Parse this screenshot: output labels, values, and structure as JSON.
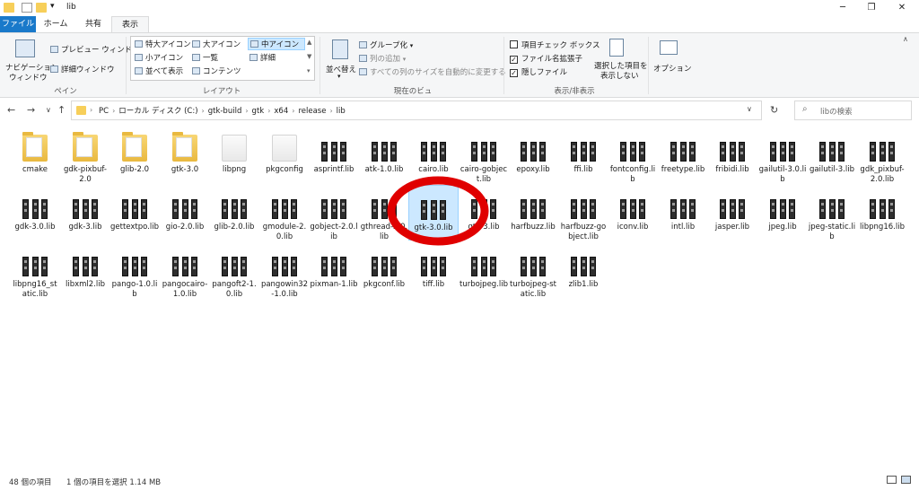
{
  "window": {
    "title": "lib",
    "controls": {
      "minimize": "─",
      "maximize": "❐",
      "close": "✕"
    }
  },
  "tabs": {
    "file": "ファイル",
    "home": "ホーム",
    "share": "共有",
    "view": "表示"
  },
  "ribbon": {
    "pane": {
      "nav_pane_1": "ナビゲーション",
      "nav_pane_2": "ウィンドウ",
      "preview": "プレビュー ウィンドウ",
      "details": "詳細ウィンドウ",
      "group": "ペイン"
    },
    "layout": {
      "extra_large": "特大アイコン",
      "large": "大アイコン",
      "medium": "中アイコン",
      "small": "小アイコン",
      "list": "一覧",
      "details": "詳細",
      "tiles": "並べて表示",
      "content": "コンテンツ",
      "group": "レイアウト"
    },
    "current_view": {
      "sort": "並べ替え",
      "group_by": "グループ化",
      "add_column": "列の追加",
      "fit_columns": "すべての列のサイズを自動的に変更する",
      "group": "現在のビュー"
    },
    "show_hide": {
      "item_checkboxes": "項目チェック ボックス",
      "extensions": "ファイル名拡張子",
      "hidden": "隠しファイル",
      "hide_selected_1": "選択した項目を",
      "hide_selected_2": "表示しない",
      "group": "表示/非表示"
    },
    "options": "オプション"
  },
  "address": {
    "crumbs": [
      "PC",
      "ローカル ディスク (C:)",
      "gtk-build",
      "gtk",
      "x64",
      "release",
      "lib"
    ],
    "search_placeholder": "libの検索"
  },
  "items": [
    {
      "name": "cmake",
      "type": "folder"
    },
    {
      "name": "gdk-pixbuf-2.0",
      "type": "folder"
    },
    {
      "name": "glib-2.0",
      "type": "folder"
    },
    {
      "name": "gtk-3.0",
      "type": "folder"
    },
    {
      "name": "libpng",
      "type": "folder-empty"
    },
    {
      "name": "pkgconfig",
      "type": "folder-empty"
    },
    {
      "name": "asprintf.lib",
      "type": "lib"
    },
    {
      "name": "atk-1.0.lib",
      "type": "lib"
    },
    {
      "name": "cairo.lib",
      "type": "lib"
    },
    {
      "name": "cairo-gobject.lib",
      "type": "lib"
    },
    {
      "name": "epoxy.lib",
      "type": "lib"
    },
    {
      "name": "ffi.lib",
      "type": "lib"
    },
    {
      "name": "fontconfig.lib",
      "type": "lib"
    },
    {
      "name": "freetype.lib",
      "type": "lib"
    },
    {
      "name": "fribidi.lib",
      "type": "lib"
    },
    {
      "name": "gailutil-3.0.lib",
      "type": "lib"
    },
    {
      "name": "gailutil-3.lib",
      "type": "lib"
    },
    {
      "name": "gdk_pixbuf-2.0.lib",
      "type": "lib"
    },
    {
      "name": "gdk-3.0.lib",
      "type": "lib"
    },
    {
      "name": "gdk-3.lib",
      "type": "lib"
    },
    {
      "name": "gettextpo.lib",
      "type": "lib"
    },
    {
      "name": "gio-2.0.lib",
      "type": "lib"
    },
    {
      "name": "glib-2.0.lib",
      "type": "lib"
    },
    {
      "name": "gmodule-2.0.lib",
      "type": "lib"
    },
    {
      "name": "gobject-2.0.lib",
      "type": "lib"
    },
    {
      "name": "gthread-2.0.lib",
      "type": "lib"
    },
    {
      "name": "gtk-3.0.lib",
      "type": "lib",
      "selected": true
    },
    {
      "name": "gtk-3.lib",
      "type": "lib"
    },
    {
      "name": "harfbuzz.lib",
      "type": "lib"
    },
    {
      "name": "harfbuzz-gobject.lib",
      "type": "lib"
    },
    {
      "name": "iconv.lib",
      "type": "lib"
    },
    {
      "name": "intl.lib",
      "type": "lib"
    },
    {
      "name": "jasper.lib",
      "type": "lib"
    },
    {
      "name": "jpeg.lib",
      "type": "lib"
    },
    {
      "name": "jpeg-static.lib",
      "type": "lib"
    },
    {
      "name": "libpng16.lib",
      "type": "lib"
    },
    {
      "name": "libpng16_static.lib",
      "type": "lib"
    },
    {
      "name": "libxml2.lib",
      "type": "lib"
    },
    {
      "name": "pango-1.0.lib",
      "type": "lib"
    },
    {
      "name": "pangocairo-1.0.lib",
      "type": "lib"
    },
    {
      "name": "pangoft2-1.0.lib",
      "type": "lib"
    },
    {
      "name": "pangowin32-1.0.lib",
      "type": "lib"
    },
    {
      "name": "pixman-1.lib",
      "type": "lib"
    },
    {
      "name": "pkgconf.lib",
      "type": "lib"
    },
    {
      "name": "tiff.lib",
      "type": "lib"
    },
    {
      "name": "turbojpeg.lib",
      "type": "lib"
    },
    {
      "name": "turbojpeg-static.lib",
      "type": "lib"
    },
    {
      "name": "zlib1.lib",
      "type": "lib"
    }
  ],
  "status": {
    "count": "48 個の項目",
    "selection": "1 個の項目を選択  1.14 MB"
  },
  "annotation": {
    "color": "#e00000",
    "icon": "red-circle"
  }
}
